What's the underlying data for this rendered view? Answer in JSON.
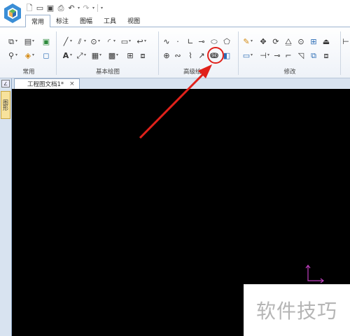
{
  "qat_icons": [
    "new-file-icon",
    "open-folder-icon",
    "save-icon",
    "print-icon",
    "undo-icon",
    "redo-icon"
  ],
  "ribbon_tabs": [
    {
      "label": "常用",
      "active": true
    },
    {
      "label": "标注",
      "active": false
    },
    {
      "label": "图幅",
      "active": false
    },
    {
      "label": "工具",
      "active": false
    },
    {
      "label": "视图",
      "active": false
    }
  ],
  "groups": {
    "common": "常用",
    "basic_draw": "基本绘图",
    "advanced_draw": "高级绘",
    "modify": "修改"
  },
  "document_tab": {
    "title": "工程图文档1*",
    "close": "×"
  },
  "left_panel": {
    "toggle": "∠",
    "tab": "图形"
  },
  "watermark": "软件技巧",
  "colors": {
    "annotation": "#e0211a",
    "ucs": "#c040c0",
    "accent": "#2b6cb5"
  }
}
